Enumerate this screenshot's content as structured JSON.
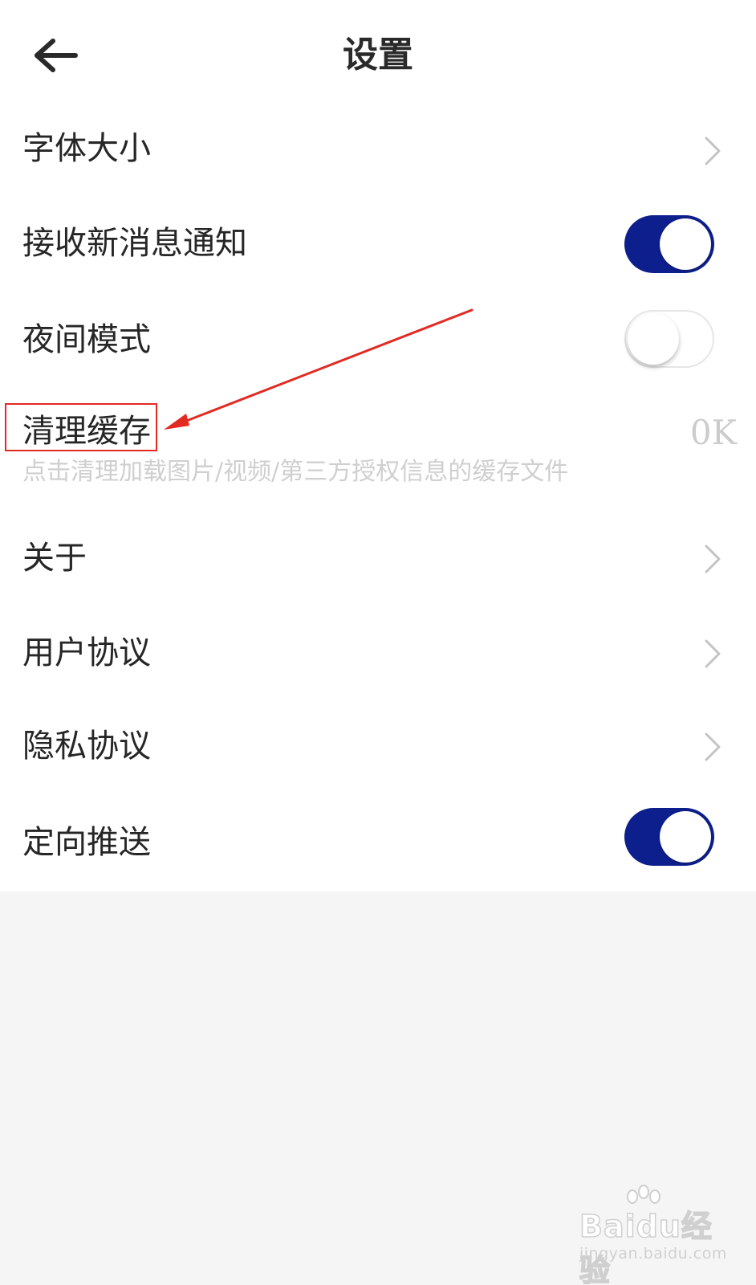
{
  "header": {
    "title": "设置",
    "back_icon": "arrow-left-icon"
  },
  "settings": {
    "font_size": {
      "label": "字体大小",
      "icon": "chevron-right-icon"
    },
    "new_message_notify": {
      "label": "接收新消息通知",
      "toggle": "on"
    },
    "night_mode": {
      "label": "夜间模式",
      "toggle": "off"
    },
    "clear_cache": {
      "label": "清理缓存",
      "value": "0K",
      "description": "点击清理加载图片/视频/第三方授权信息的缓存文件"
    },
    "about": {
      "label": "关于",
      "icon": "chevron-right-icon"
    },
    "user_agreement": {
      "label": "用户协议",
      "icon": "chevron-right-icon"
    },
    "privacy_agreement": {
      "label": "隐私协议",
      "icon": "chevron-right-icon"
    },
    "targeted_push": {
      "label": "定向推送",
      "toggle": "on"
    }
  },
  "watermark": {
    "brand": "Baidu经验",
    "url": "jingyan.baidu.com"
  },
  "colors": {
    "toggle_on": "#0d1f8c",
    "annotation": "#e32a22",
    "background": "#f5f5f5"
  }
}
